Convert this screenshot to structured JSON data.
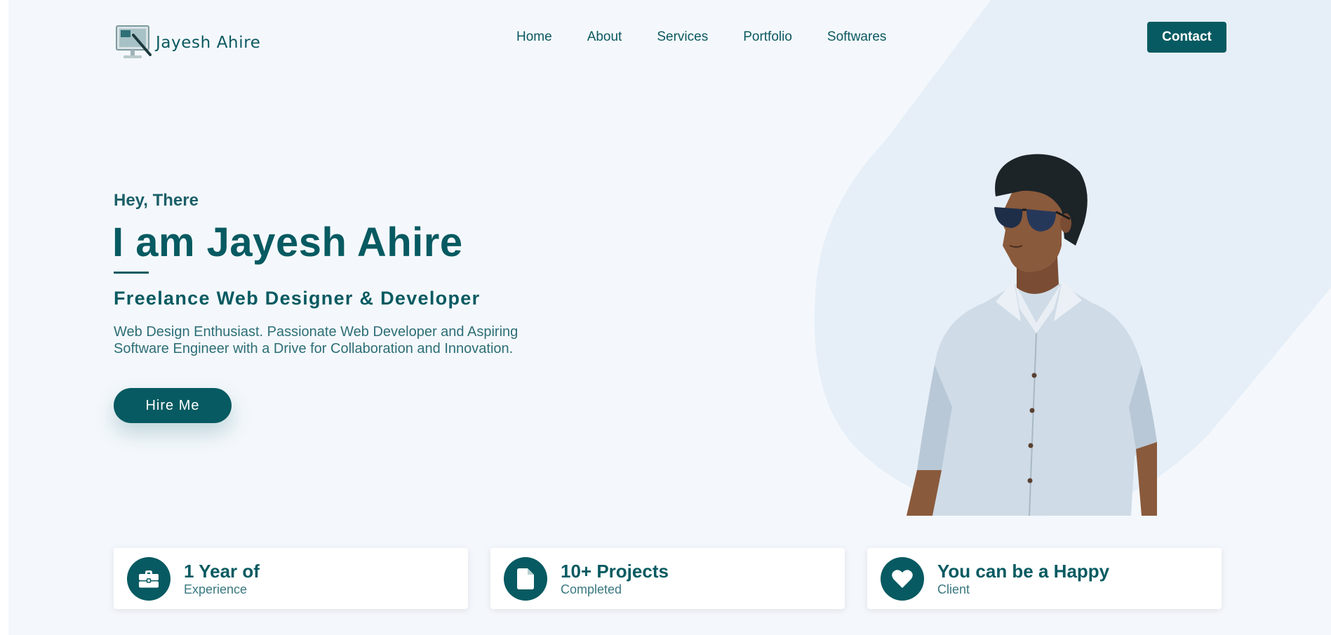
{
  "brand": {
    "name": "Jayesh Ahire",
    "logo_icon": "monitor-pen-icon"
  },
  "nav": {
    "items": [
      {
        "label": "Home"
      },
      {
        "label": "About"
      },
      {
        "label": "Services"
      },
      {
        "label": "Portfolio"
      },
      {
        "label": "Softwares"
      }
    ],
    "contact_label": "Contact"
  },
  "hero": {
    "greeting": "Hey, There",
    "headline": "I am Jayesh Ahire",
    "subheadline": "Freelance Web Designer & Developer",
    "description": "Web Design Enthusiast. Passionate Web Developer and Aspiring Software Engineer with a Drive for Collaboration and Innovation.",
    "cta_label": "Hire Me"
  },
  "stats": [
    {
      "icon": "briefcase-icon",
      "title": "1 Year of",
      "subtitle": "Experience"
    },
    {
      "icon": "document-icon",
      "title": "10+ Projects",
      "subtitle": "Completed"
    },
    {
      "icon": "heart-icon",
      "title": "You can be a Happy",
      "subtitle": "Client"
    }
  ],
  "colors": {
    "primary": "#075a61",
    "background": "#f4f8fc",
    "blob": "#e6eff8"
  }
}
